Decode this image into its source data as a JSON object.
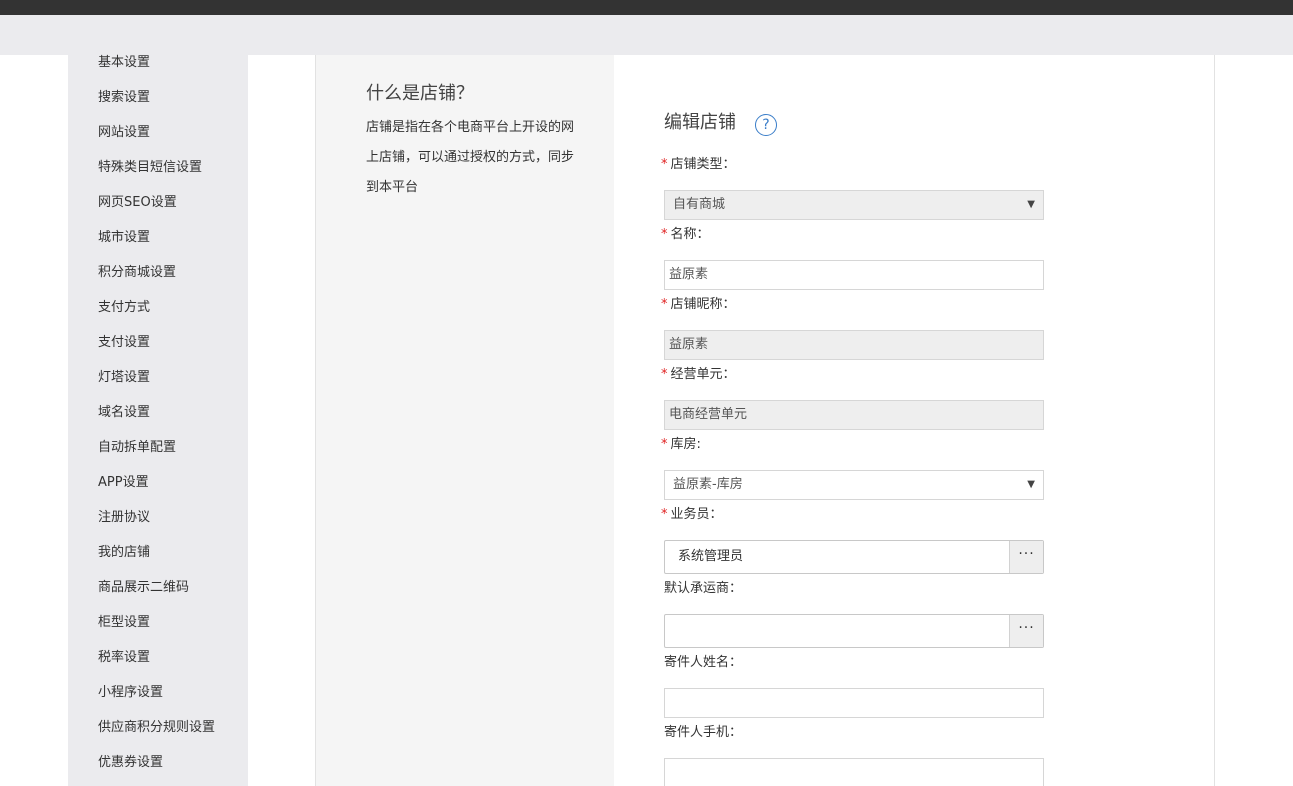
{
  "sidebar": {
    "items": [
      {
        "label": "基本设置"
      },
      {
        "label": "搜索设置"
      },
      {
        "label": "网站设置"
      },
      {
        "label": "特殊类目短信设置"
      },
      {
        "label": "网页SEO设置"
      },
      {
        "label": "城市设置"
      },
      {
        "label": "积分商城设置"
      },
      {
        "label": "支付方式"
      },
      {
        "label": "支付设置"
      },
      {
        "label": "灯塔设置"
      },
      {
        "label": "域名设置"
      },
      {
        "label": "自动拆单配置"
      },
      {
        "label": "APP设置"
      },
      {
        "label": "注册协议"
      },
      {
        "label": "我的店铺"
      },
      {
        "label": "商品展示二维码"
      },
      {
        "label": "柜型设置"
      },
      {
        "label": "税率设置"
      },
      {
        "label": "小程序设置"
      },
      {
        "label": "供应商积分规则设置"
      },
      {
        "label": "优惠券设置"
      }
    ]
  },
  "help": {
    "title": "什么是店铺？",
    "body": "店铺是指在各个电商平台上开设的网上店铺，可以通过授权的方式，同步到本平台"
  },
  "form": {
    "title": "编辑店铺",
    "help_icon": "question-circle-icon",
    "required_mark": "*",
    "store_type": {
      "label": "店铺类型：",
      "value": "自有商城"
    },
    "name": {
      "label": "名称：",
      "value": "益原素"
    },
    "nickname": {
      "label": "店铺昵称：",
      "value": "益原素"
    },
    "business_unit": {
      "label": "经营单元：",
      "value": "电商经营单元"
    },
    "warehouse": {
      "label": "库房:",
      "value": "益原素-库房"
    },
    "salesperson": {
      "label": "业务员：",
      "value": "系统管理员",
      "button": "···"
    },
    "carrier": {
      "label": "默认承运商：",
      "value": "",
      "button": "···"
    },
    "sender_name": {
      "label": "寄件人姓名：",
      "value": ""
    },
    "sender_phone": {
      "label": "寄件人手机：",
      "value": ""
    }
  },
  "colors": {
    "topbar": "#333333",
    "subbar": "#ebebee",
    "sidebar": "#ebebee",
    "help_panel": "#f5f5f5",
    "required": "#e02020",
    "accent": "#3b7ec9"
  }
}
